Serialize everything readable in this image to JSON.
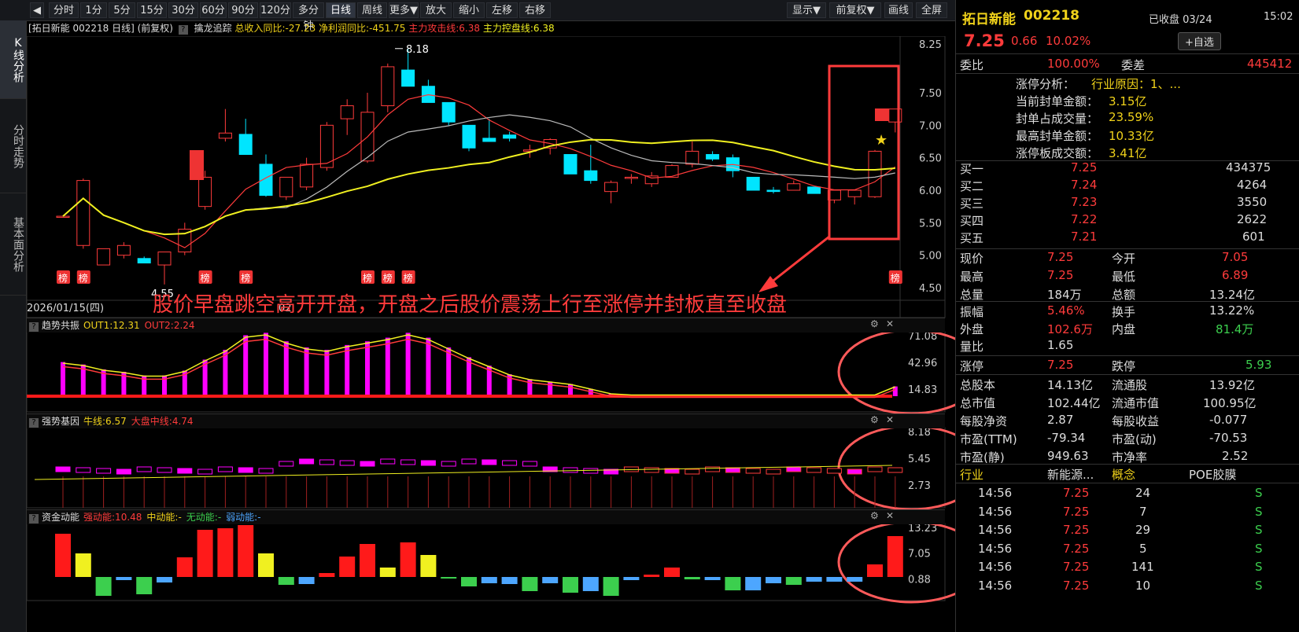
{
  "toolbar": {
    "back_icon": "back-arrow-icon",
    "periods": [
      "分时",
      "1分",
      "5分",
      "15分",
      "30分",
      "60分",
      "90分",
      "120分",
      "多分钟",
      "日线",
      "周线",
      "更多▼",
      "放大",
      "缩小",
      "左移",
      "右移"
    ],
    "active_period": "日线",
    "right_buttons": [
      "显示▼",
      "前复权▼",
      "画线",
      "全屏"
    ]
  },
  "leftnav": [
    "K线分析",
    "分时走势",
    "基本面分析"
  ],
  "chart": {
    "header_title": "[拓日新能 002218 日线] (前复权)",
    "indicator_name": "擒龙追踪",
    "indicator_values": [
      "总收入同比:-27.23",
      "净利润同比:-451.75",
      "主力攻击线:6.38"
    ],
    "indicator_value_yellow": "主力控盘线:6.38",
    "price_axis": [
      "8.25",
      "7.50",
      "7.00",
      "6.50",
      "6.00",
      "5.50",
      "5.00",
      "4.50"
    ],
    "high_label": "8.18",
    "low_label": "4.55",
    "bang_label": "榜",
    "date_label": "2026/01/15(四)",
    "month_label": "02",
    "annotation": "股价早盘跳空高开开盘，开盘之后股价震荡上行至涨停并封板直至收盘",
    "star_icon": "star-icon"
  },
  "panels": [
    {
      "name": "趋势共振",
      "values": [
        {
          "text": "OUT1:12.31",
          "color": "#f0d21a"
        },
        {
          "text": "OUT2:2.24",
          "color": "#ff3b3b"
        }
      ],
      "axis": [
        "71.08",
        "42.96",
        "14.83"
      ]
    },
    {
      "name": "强势基因",
      "values": [
        {
          "text": "牛线:6.57",
          "color": "#f0d21a"
        },
        {
          "text": "大盘中线:4.74",
          "color": "#ff3b3b"
        }
      ],
      "axis": [
        "8.18",
        "5.45",
        "2.73"
      ]
    },
    {
      "name": "资金动能",
      "values": [
        {
          "text": "强动能:10.48",
          "color": "#ff3b3b"
        },
        {
          "text": "中动能:-",
          "color": "#f0d21a"
        },
        {
          "text": "无动能:-",
          "color": "#3ccf4e"
        },
        {
          "text": "弱动能:-",
          "color": "#4da6ff"
        }
      ],
      "axis": [
        "13.23",
        "7.05",
        "0.88"
      ]
    }
  ],
  "stock": {
    "name": "拓日新能",
    "code": "002218",
    "status": "已收盘 03/24",
    "time": "15:02",
    "price": "7.25",
    "change": "0.66",
    "pct": "10.02%",
    "watch_button": "+自选",
    "wb_label": "委比",
    "wb": "100.00%",
    "wc_label": "委差",
    "wc": "445412",
    "limit_analysis": [
      {
        "label": "涨停分析：",
        "value": "行业原因：1、..."
      },
      {
        "label": "当前封单金额：",
        "value": "3.15亿"
      },
      {
        "label": "封单占成交量：",
        "value": "23.59%"
      },
      {
        "label": "最高封单金额：",
        "value": "10.33亿"
      },
      {
        "label": "涨停板成交额：",
        "value": "3.41亿"
      }
    ],
    "bids": [
      {
        "label": "买一",
        "price": "7.25",
        "vol": "434375"
      },
      {
        "label": "买二",
        "price": "7.24",
        "vol": "4264"
      },
      {
        "label": "买三",
        "price": "7.23",
        "vol": "3550"
      },
      {
        "label": "买四",
        "price": "7.22",
        "vol": "2622"
      },
      {
        "label": "买五",
        "price": "7.21",
        "vol": "601"
      }
    ],
    "quote": [
      {
        "l1": "现价",
        "v1": "7.25",
        "c1": "red",
        "l2": "今开",
        "v2": "7.05",
        "c2": "red"
      },
      {
        "l1": "最高",
        "v1": "7.25",
        "c1": "red",
        "l2": "最低",
        "v2": "6.89",
        "c2": "red"
      },
      {
        "l1": "总量",
        "v1": "184万",
        "c1": "wht",
        "l2": "总额",
        "v2": "13.24亿",
        "c2": "wht"
      }
    ],
    "stats1": [
      {
        "l1": "振幅",
        "v1": "5.46%",
        "c1": "red",
        "l2": "换手",
        "v2": "13.22%",
        "c2": "wht"
      },
      {
        "l1": "外盘",
        "v1": "102.6万",
        "c1": "red",
        "l2": "内盘",
        "v2": "81.4万",
        "c2": "green"
      },
      {
        "l1": "量比",
        "v1": "1.65",
        "c1": "wht",
        "l2": "",
        "v2": "",
        "c2": "wht"
      }
    ],
    "limit_row": {
      "l1": "涨停",
      "v1": "7.25",
      "l2": "跌停",
      "v2": "5.93"
    },
    "fund": [
      {
        "l1": "总股本",
        "v1": "14.13亿",
        "l2": "流通股",
        "v2": "13.92亿"
      },
      {
        "l1": "总市值",
        "v1": "102.44亿",
        "l2": "流通市值",
        "v2": "100.95亿"
      },
      {
        "l1": "每股净资",
        "v1": "2.87",
        "l2": "每股收益",
        "v2": "-0.077"
      },
      {
        "l1": "市盈(TTM)",
        "v1": "-79.34",
        "l2": "市盈(动)",
        "v2": "-70.53"
      },
      {
        "l1": "市盈(静)",
        "v1": "949.63",
        "l2": "市净率",
        "v2": "2.52"
      }
    ],
    "industry": {
      "l1": "行业",
      "v1": "新能源...",
      "l2": "概念",
      "v2": "POE胶膜"
    },
    "ticks": [
      {
        "time": "14:56",
        "price": "7.25",
        "vol": "24",
        "side": "S"
      },
      {
        "time": "14:56",
        "price": "7.25",
        "vol": "7",
        "side": "S"
      },
      {
        "time": "14:56",
        "price": "7.25",
        "vol": "29",
        "side": "S"
      },
      {
        "time": "14:56",
        "price": "7.25",
        "vol": "5",
        "side": "S"
      },
      {
        "time": "14:56",
        "price": "7.25",
        "vol": "141",
        "side": "S"
      },
      {
        "time": "14:56",
        "price": "7.25",
        "vol": "10",
        "side": "S"
      }
    ]
  },
  "colors": {
    "up": "#ff3b3b",
    "down": "#00e5ff",
    "ma_yellow": "#f0f020",
    "accent_red": "#ff3b3b"
  }
}
